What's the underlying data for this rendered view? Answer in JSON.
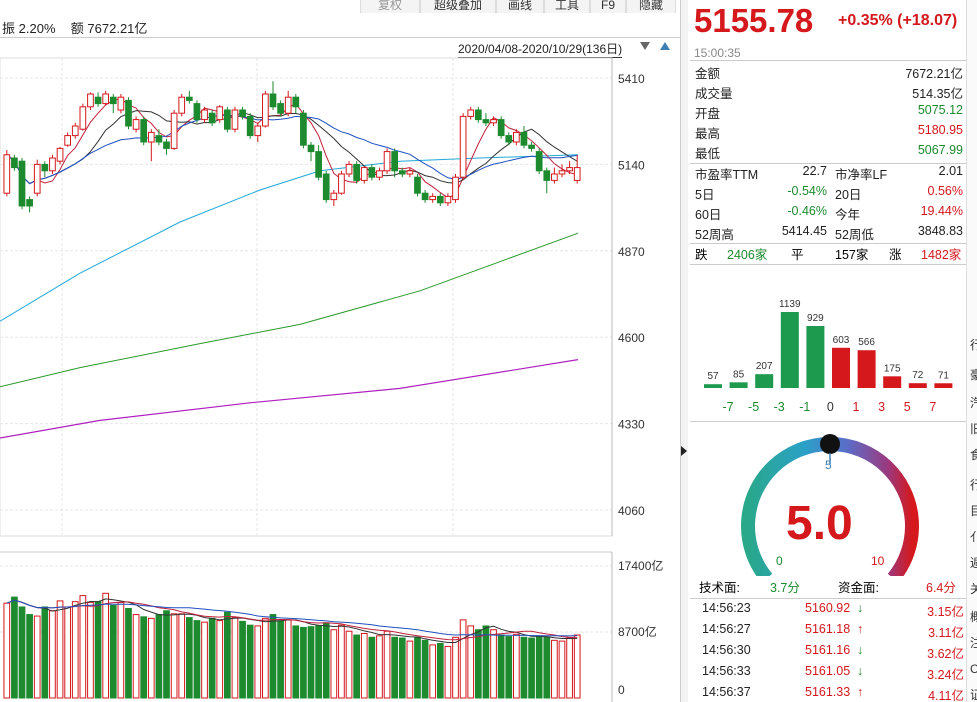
{
  "toolbar": {
    "buttons": [
      "复权",
      "超级叠加",
      "画线",
      "工具",
      "F9",
      "隐藏"
    ]
  },
  "chart_header": {
    "amplitude_label": "振",
    "amplitude_value": "2.20%",
    "amount_label": "额",
    "amount_value": "7672.21亿",
    "date_range": "2020/04/08-2020/10/29(136日)"
  },
  "price_axis": [
    "5410",
    "5140",
    "4870",
    "4600",
    "4330",
    "4060"
  ],
  "volume_axis": [
    "17400亿",
    "8700亿",
    "0"
  ],
  "colors": {
    "up": "#d4181c",
    "down": "#1d8a2e",
    "accent_blue": "#3f7fb4"
  },
  "chart_data": {
    "type": "candlestick",
    "description_of_axes": "price with MA lines; volume bars below",
    "ylim": [
      4060,
      5410
    ],
    "volume_ylim": [
      0,
      17400
    ],
    "candles": [
      {
        "o": 5050,
        "c": 5170,
        "h": 5185,
        "l": 5040,
        "up": true
      },
      {
        "o": 5160,
        "c": 5130,
        "h": 5170,
        "l": 5120,
        "up": false
      },
      {
        "o": 5150,
        "c": 5010,
        "h": 5160,
        "l": 5000,
        "up": false
      },
      {
        "o": 5030,
        "c": 5010,
        "h": 5040,
        "l": 4990,
        "up": false
      },
      {
        "o": 5050,
        "c": 5140,
        "h": 5155,
        "l": 5040,
        "up": true
      },
      {
        "o": 5140,
        "c": 5120,
        "h": 5150,
        "l": 5100,
        "up": false
      },
      {
        "o": 5120,
        "c": 5160,
        "h": 5170,
        "l": 5110,
        "up": true
      },
      {
        "o": 5150,
        "c": 5190,
        "h": 5195,
        "l": 5140,
        "up": true
      },
      {
        "o": 5200,
        "c": 5230,
        "h": 5240,
        "l": 5195,
        "up": true
      },
      {
        "o": 5230,
        "c": 5260,
        "h": 5270,
        "l": 5220,
        "up": true
      },
      {
        "o": 5250,
        "c": 5320,
        "h": 5330,
        "l": 5245,
        "up": true
      },
      {
        "o": 5320,
        "c": 5360,
        "h": 5365,
        "l": 5310,
        "up": true
      },
      {
        "o": 5350,
        "c": 5330,
        "h": 5365,
        "l": 5320,
        "up": false
      },
      {
        "o": 5330,
        "c": 5360,
        "h": 5370,
        "l": 5325,
        "up": true
      },
      {
        "o": 5350,
        "c": 5330,
        "h": 5360,
        "l": 5300,
        "up": false
      },
      {
        "o": 5310,
        "c": 5350,
        "h": 5360,
        "l": 5300,
        "up": true
      },
      {
        "o": 5340,
        "c": 5260,
        "h": 5350,
        "l": 5250,
        "up": false
      },
      {
        "o": 5250,
        "c": 5280,
        "h": 5290,
        "l": 5240,
        "up": true
      },
      {
        "o": 5280,
        "c": 5210,
        "h": 5290,
        "l": 5200,
        "up": false
      },
      {
        "o": 5210,
        "c": 5240,
        "h": 5250,
        "l": 5150,
        "up": true
      },
      {
        "o": 5230,
        "c": 5210,
        "h": 5250,
        "l": 5200,
        "up": false
      },
      {
        "o": 5210,
        "c": 5190,
        "h": 5220,
        "l": 5170,
        "up": false
      },
      {
        "o": 5190,
        "c": 5300,
        "h": 5310,
        "l": 5185,
        "up": true
      },
      {
        "o": 5300,
        "c": 5350,
        "h": 5360,
        "l": 5290,
        "up": true
      },
      {
        "o": 5350,
        "c": 5340,
        "h": 5370,
        "l": 5330,
        "up": false
      },
      {
        "o": 5330,
        "c": 5280,
        "h": 5340,
        "l": 5270,
        "up": false
      },
      {
        "o": 5280,
        "c": 5310,
        "h": 5320,
        "l": 5270,
        "up": true
      },
      {
        "o": 5300,
        "c": 5270,
        "h": 5310,
        "l": 5260,
        "up": false
      },
      {
        "o": 5280,
        "c": 5320,
        "h": 5325,
        "l": 5270,
        "up": true
      },
      {
        "o": 5310,
        "c": 5250,
        "h": 5320,
        "l": 5240,
        "up": false
      },
      {
        "o": 5250,
        "c": 5310,
        "h": 5320,
        "l": 5240,
        "up": true
      },
      {
        "o": 5310,
        "c": 5290,
        "h": 5320,
        "l": 5280,
        "up": false
      },
      {
        "o": 5290,
        "c": 5230,
        "h": 5300,
        "l": 5220,
        "up": false
      },
      {
        "o": 5230,
        "c": 5260,
        "h": 5270,
        "l": 5210,
        "up": true
      },
      {
        "o": 5260,
        "c": 5360,
        "h": 5370,
        "l": 5255,
        "up": true
      },
      {
        "o": 5360,
        "c": 5320,
        "h": 5400,
        "l": 5310,
        "up": false
      },
      {
        "o": 5330,
        "c": 5300,
        "h": 5340,
        "l": 5290,
        "up": false
      },
      {
        "o": 5300,
        "c": 5350,
        "h": 5370,
        "l": 5290,
        "up": true
      },
      {
        "o": 5350,
        "c": 5320,
        "h": 5360,
        "l": 5300,
        "up": false
      },
      {
        "o": 5300,
        "c": 5200,
        "h": 5310,
        "l": 5190,
        "up": false
      },
      {
        "o": 5200,
        "c": 5180,
        "h": 5210,
        "l": 5150,
        "up": false
      },
      {
        "o": 5180,
        "c": 5100,
        "h": 5200,
        "l": 5090,
        "up": false
      },
      {
        "o": 5110,
        "c": 5030,
        "h": 5120,
        "l": 5020,
        "up": false
      },
      {
        "o": 5030,
        "c": 5050,
        "h": 5060,
        "l": 5010,
        "up": true
      },
      {
        "o": 5050,
        "c": 5110,
        "h": 5120,
        "l": 5045,
        "up": true
      },
      {
        "o": 5110,
        "c": 5140,
        "h": 5150,
        "l": 5100,
        "up": true
      },
      {
        "o": 5140,
        "c": 5090,
        "h": 5150,
        "l": 5080,
        "up": false
      },
      {
        "o": 5090,
        "c": 5130,
        "h": 5135,
        "l": 5080,
        "up": true
      },
      {
        "o": 5130,
        "c": 5100,
        "h": 5140,
        "l": 5090,
        "up": false
      },
      {
        "o": 5100,
        "c": 5120,
        "h": 5130,
        "l": 5090,
        "up": true
      },
      {
        "o": 5120,
        "c": 5180,
        "h": 5190,
        "l": 5110,
        "up": true
      },
      {
        "o": 5180,
        "c": 5120,
        "h": 5190,
        "l": 5100,
        "up": false
      },
      {
        "o": 5120,
        "c": 5110,
        "h": 5130,
        "l": 5100,
        "up": false
      },
      {
        "o": 5110,
        "c": 5120,
        "h": 5130,
        "l": 5100,
        "up": true
      },
      {
        "o": 5100,
        "c": 5050,
        "h": 5110,
        "l": 5040,
        "up": false
      },
      {
        "o": 5050,
        "c": 5030,
        "h": 5060,
        "l": 5020,
        "up": false
      },
      {
        "o": 5030,
        "c": 5040,
        "h": 5050,
        "l": 5020,
        "up": true
      },
      {
        "o": 5040,
        "c": 5020,
        "h": 5050,
        "l": 5010,
        "up": false
      },
      {
        "o": 5020,
        "c": 5040,
        "h": 5050,
        "l": 5010,
        "up": true
      },
      {
        "o": 5030,
        "c": 5100,
        "h": 5110,
        "l": 5020,
        "up": true
      },
      {
        "o": 5100,
        "c": 5290,
        "h": 5300,
        "l": 5090,
        "up": true
      },
      {
        "o": 5290,
        "c": 5310,
        "h": 5320,
        "l": 5280,
        "up": true
      },
      {
        "o": 5310,
        "c": 5280,
        "h": 5320,
        "l": 5270,
        "up": false
      },
      {
        "o": 5280,
        "c": 5270,
        "h": 5300,
        "l": 5260,
        "up": false
      },
      {
        "o": 5270,
        "c": 5280,
        "h": 5290,
        "l": 5260,
        "up": true
      },
      {
        "o": 5280,
        "c": 5230,
        "h": 5290,
        "l": 5220,
        "up": false
      },
      {
        "o": 5230,
        "c": 5210,
        "h": 5240,
        "l": 5200,
        "up": false
      },
      {
        "o": 5210,
        "c": 5240,
        "h": 5250,
        "l": 5200,
        "up": true
      },
      {
        "o": 5240,
        "c": 5200,
        "h": 5260,
        "l": 5190,
        "up": false
      },
      {
        "o": 5200,
        "c": 5190,
        "h": 5210,
        "l": 5180,
        "up": false
      },
      {
        "o": 5180,
        "c": 5120,
        "h": 5190,
        "l": 5110,
        "up": false
      },
      {
        "o": 5120,
        "c": 5090,
        "h": 5130,
        "l": 5050,
        "up": false
      },
      {
        "o": 5090,
        "c": 5110,
        "h": 5130,
        "l": 5080,
        "up": true
      },
      {
        "o": 5110,
        "c": 5120,
        "h": 5140,
        "l": 5100,
        "up": true
      },
      {
        "o": 5120,
        "c": 5130,
        "h": 5150,
        "l": 5110,
        "up": true
      },
      {
        "o": 5130,
        "c": 5090,
        "h": 5170,
        "l": 5080,
        "up": true
      }
    ],
    "volumes": [
      {
        "v": 12500,
        "up": true
      },
      {
        "v": 13300,
        "up": false
      },
      {
        "v": 12000,
        "up": false
      },
      {
        "v": 11000,
        "up": false
      },
      {
        "v": 10800,
        "up": true
      },
      {
        "v": 12000,
        "up": false
      },
      {
        "v": 11500,
        "up": true
      },
      {
        "v": 12800,
        "up": true
      },
      {
        "v": 12000,
        "up": true
      },
      {
        "v": 12700,
        "up": true
      },
      {
        "v": 13500,
        "up": true
      },
      {
        "v": 12600,
        "up": true
      },
      {
        "v": 12700,
        "up": false
      },
      {
        "v": 13800,
        "up": true
      },
      {
        "v": 12200,
        "up": false
      },
      {
        "v": 12600,
        "up": true
      },
      {
        "v": 11800,
        "up": false
      },
      {
        "v": 11000,
        "up": true
      },
      {
        "v": 10700,
        "up": false
      },
      {
        "v": 10500,
        "up": true
      },
      {
        "v": 11000,
        "up": false
      },
      {
        "v": 11500,
        "up": false
      },
      {
        "v": 11100,
        "up": true
      },
      {
        "v": 11100,
        "up": true
      },
      {
        "v": 10600,
        "up": false
      },
      {
        "v": 10200,
        "up": false
      },
      {
        "v": 10000,
        "up": true
      },
      {
        "v": 10500,
        "up": false
      },
      {
        "v": 10200,
        "up": true
      },
      {
        "v": 11300,
        "up": false
      },
      {
        "v": 10600,
        "up": true
      },
      {
        "v": 10100,
        "up": false
      },
      {
        "v": 9600,
        "up": false
      },
      {
        "v": 9500,
        "up": true
      },
      {
        "v": 10500,
        "up": true
      },
      {
        "v": 11000,
        "up": false
      },
      {
        "v": 10200,
        "up": false
      },
      {
        "v": 10300,
        "up": true
      },
      {
        "v": 9500,
        "up": false
      },
      {
        "v": 9300,
        "up": false
      },
      {
        "v": 9400,
        "up": false
      },
      {
        "v": 9500,
        "up": false
      },
      {
        "v": 9900,
        "up": false
      },
      {
        "v": 9000,
        "up": true
      },
      {
        "v": 9600,
        "up": true
      },
      {
        "v": 8800,
        "up": true
      },
      {
        "v": 8300,
        "up": false
      },
      {
        "v": 8500,
        "up": true
      },
      {
        "v": 8000,
        "up": false
      },
      {
        "v": 8200,
        "up": true
      },
      {
        "v": 8800,
        "up": true
      },
      {
        "v": 8000,
        "up": false
      },
      {
        "v": 7900,
        "up": false
      },
      {
        "v": 7500,
        "up": true
      },
      {
        "v": 8000,
        "up": false
      },
      {
        "v": 7600,
        "up": false
      },
      {
        "v": 7000,
        "up": true
      },
      {
        "v": 7200,
        "up": false
      },
      {
        "v": 6800,
        "up": true
      },
      {
        "v": 8000,
        "up": true
      },
      {
        "v": 10300,
        "up": true
      },
      {
        "v": 9500,
        "up": true
      },
      {
        "v": 9000,
        "up": false
      },
      {
        "v": 9500,
        "up": false
      },
      {
        "v": 9000,
        "up": true
      },
      {
        "v": 8300,
        "up": false
      },
      {
        "v": 8100,
        "up": false
      },
      {
        "v": 8400,
        "up": true
      },
      {
        "v": 8000,
        "up": false
      },
      {
        "v": 7900,
        "up": false
      },
      {
        "v": 8200,
        "up": false
      },
      {
        "v": 8000,
        "up": false
      },
      {
        "v": 7600,
        "up": true
      },
      {
        "v": 7500,
        "up": true
      },
      {
        "v": 7900,
        "up": true
      },
      {
        "v": 8300,
        "up": true
      }
    ]
  },
  "quote": {
    "price": "5155.78",
    "change": "+0.35% (+18.07)",
    "time": "15:00:35"
  },
  "stats": [
    {
      "label": "金额",
      "value": "7672.21亿",
      "color": "#222"
    },
    {
      "label": "成交量",
      "value": "514.35亿",
      "color": "#222"
    },
    {
      "label": "开盘",
      "value": "5075.12",
      "color": "#1d8a2e"
    },
    {
      "label": "最高",
      "value": "5180.95",
      "color": "#d4181c"
    },
    {
      "label": "最低",
      "value": "5067.99",
      "color": "#1d8a2e"
    }
  ],
  "stats2": [
    {
      "l1": "市盈率TTM",
      "v1": "22.7",
      "c1": "#222",
      "l2": "市净率LF",
      "v2": "2.01",
      "c2": "#222"
    },
    {
      "l1": "5日",
      "v1": "-0.54%",
      "c1": "#1d8a2e",
      "l2": "20日",
      "v2": "0.56%",
      "c2": "#d4181c"
    },
    {
      "l1": "60日",
      "v1": "-0.46%",
      "c1": "#1d8a2e",
      "l2": "今年",
      "v2": "19.44%",
      "c2": "#d4181c"
    },
    {
      "l1": "52周高",
      "v1": "5414.45",
      "c1": "#222",
      "l2": "52周低",
      "v2": "3848.83",
      "c2": "#222"
    }
  ],
  "breadth": {
    "down_label": "跌",
    "down_value": "2406家",
    "flat_label": "平",
    "flat_value": "157家",
    "up_label": "涨",
    "up_value": "1482家"
  },
  "distribution": {
    "values": [
      57,
      85,
      207,
      1139,
      929,
      603,
      566,
      175,
      72,
      71
    ],
    "ticks": [
      "-7",
      "-5",
      "-3",
      "-1",
      "0",
      "1",
      "3",
      "5",
      "7"
    ],
    "max": 1139
  },
  "gauge": {
    "score": "5.0",
    "marker": "5",
    "min": "0",
    "max": "10",
    "tech_label": "技术面:",
    "tech_value": "3.7分",
    "fund_label": "资金面:",
    "fund_value": "6.4分"
  },
  "ticks_list": [
    {
      "time": "14:56:23",
      "price": "5160.92",
      "dir": "down",
      "amount": "3.15亿"
    },
    {
      "time": "14:56:27",
      "price": "5161.18",
      "dir": "up",
      "amount": "3.11亿"
    },
    {
      "time": "14:56:30",
      "price": "5161.16",
      "dir": "down",
      "amount": "3.62亿"
    },
    {
      "time": "14:56:33",
      "price": "5161.05",
      "dir": "down",
      "amount": "3.24亿"
    },
    {
      "time": "14:56:37",
      "price": "5161.33",
      "dir": "up",
      "amount": "4.11亿"
    }
  ],
  "side_chars": [
    "行",
    "豪",
    "汽",
    "旧",
    "食",
    "行",
    "目",
    "亻",
    "逅",
    "关",
    "概",
    "注",
    "C",
    "证"
  ]
}
